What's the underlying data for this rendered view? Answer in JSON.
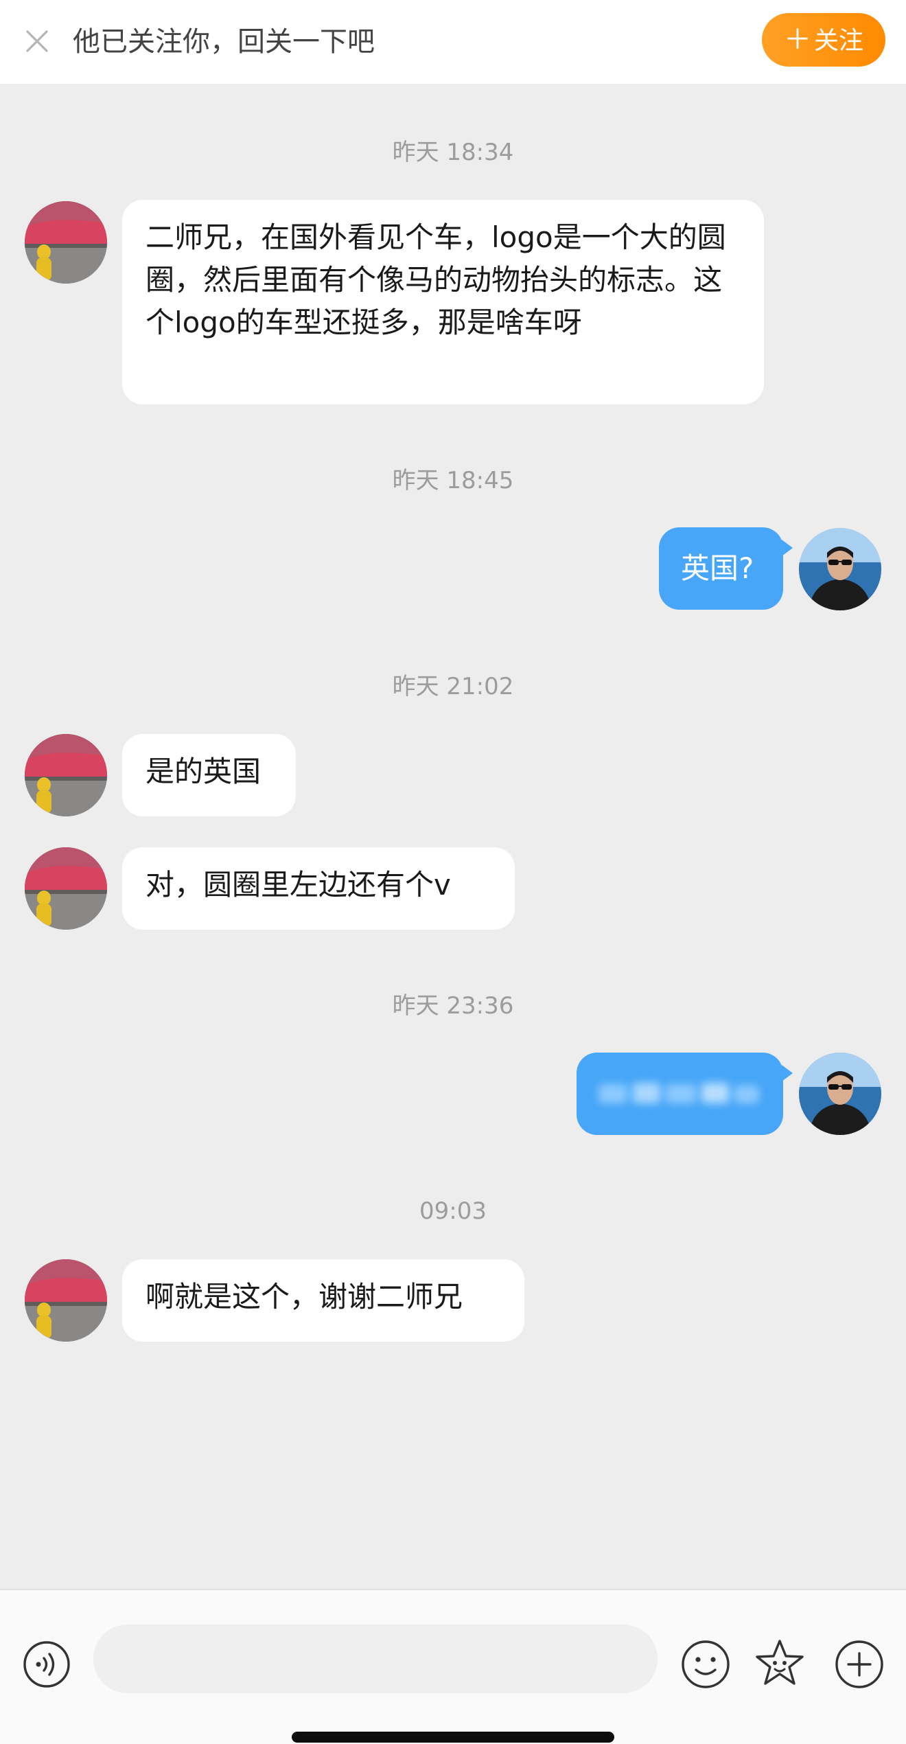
{
  "banner": {
    "text": "他已关注你，回关一下吧",
    "follow_label": "关注",
    "follow_plus": "＋"
  },
  "messages": [
    {
      "type": "timestamp",
      "text": "昨天 18:34"
    },
    {
      "type": "incoming",
      "text": "二师兄，在国外看见个车，logo是一个大的圆圈，然后里面有个像马的动物抬头的标志。这个logo的车型还挺多，那是啥车呀"
    },
    {
      "type": "timestamp",
      "text": "昨天 18:45"
    },
    {
      "type": "outgoing",
      "text": "英国?"
    },
    {
      "type": "timestamp",
      "text": "昨天 21:02"
    },
    {
      "type": "incoming",
      "text": "是的英国"
    },
    {
      "type": "incoming",
      "text": "对，圆圈里左边还有个v"
    },
    {
      "type": "timestamp",
      "text": "昨天 23:36"
    },
    {
      "type": "outgoing",
      "text": "",
      "blurred": true
    },
    {
      "type": "timestamp",
      "text": "09:03"
    },
    {
      "type": "incoming",
      "text": "啊就是这个，谢谢二师兄"
    }
  ],
  "input": {
    "placeholder": ""
  },
  "icons": {
    "close": "close-icon",
    "voice": "voice-icon",
    "emoji": "emoji-icon",
    "sticker": "sticker-icon",
    "plus": "plus-circle-icon"
  },
  "colors": {
    "follow_button": "#ff9410",
    "outgoing_bubble": "#47a6f7",
    "incoming_bubble": "#ffffff",
    "chat_background": "#ededed"
  }
}
